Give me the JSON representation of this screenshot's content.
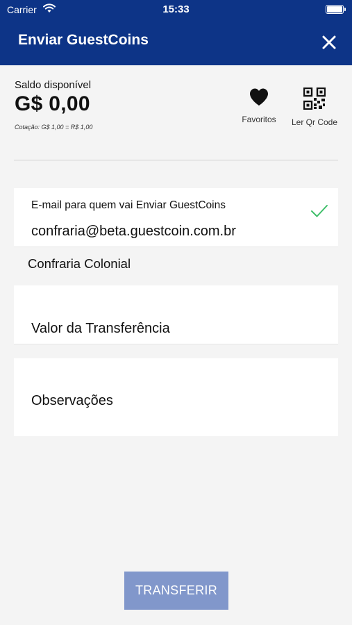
{
  "status_bar": {
    "carrier": "Carrier",
    "time": "15:33",
    "icons": [
      "wifi-icon",
      "battery-icon"
    ]
  },
  "header": {
    "title": "Enviar GuestCoins",
    "close_icon": "close-icon"
  },
  "balance": {
    "label": "Saldo disponível",
    "value": "G$ 0,00",
    "rate": "Cotação: G$ 1,00 = R$ 1,00"
  },
  "actions": {
    "favorites": {
      "label": "Favoritos",
      "icon": "heart-icon"
    },
    "qr": {
      "label": "Ler Qr Code",
      "icon": "qr-code-icon"
    }
  },
  "form": {
    "email": {
      "label": "E-mail para quem vai Enviar GuestCoins",
      "value": "confraria@beta.guestcoin.com.br",
      "valid": true
    },
    "recipient_name": "Confraria Colonial",
    "amount": {
      "placeholder": "Valor da Transferência"
    },
    "notes": {
      "placeholder": "Observações"
    }
  },
  "submit": {
    "label": "TRANSFERIR",
    "disabled": true
  },
  "colors": {
    "header": "#0d3487",
    "background": "#f4f4f4",
    "check": "#3fbf6a",
    "button": "#8197cb"
  }
}
